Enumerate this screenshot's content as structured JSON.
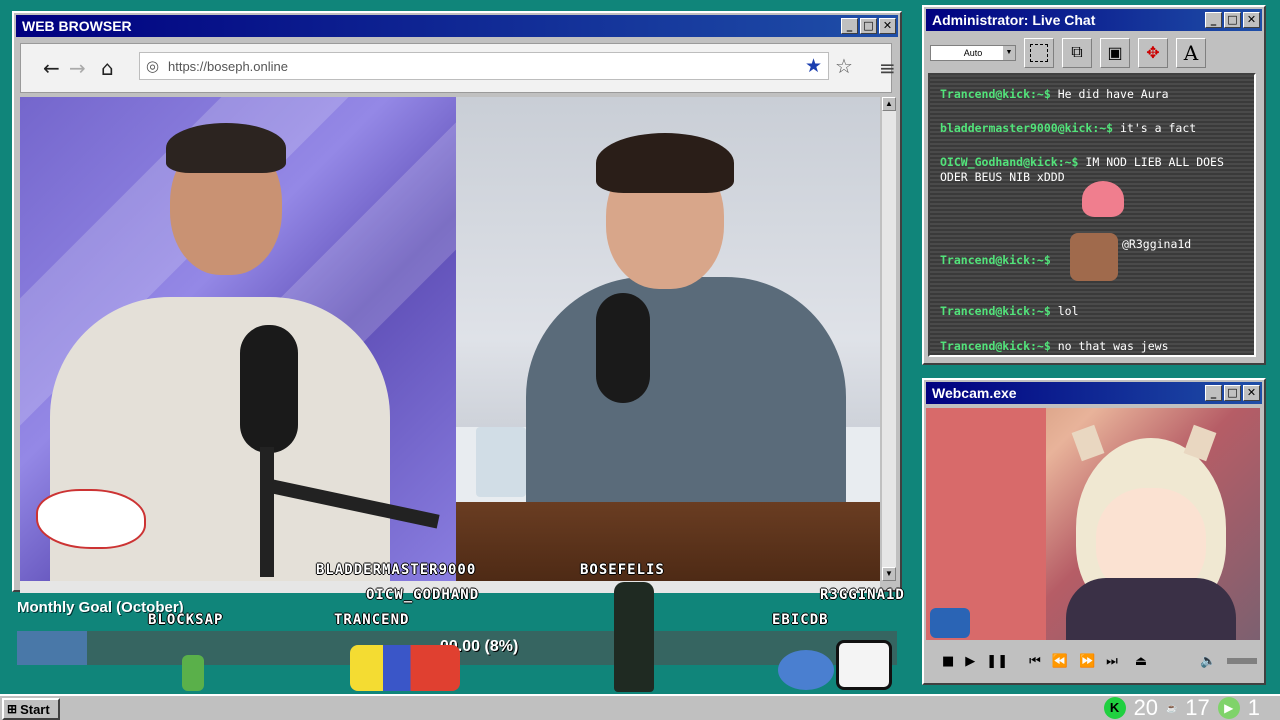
{
  "browser": {
    "title": "WEB BROWSER",
    "url": "https://boseph.online",
    "window_buttons": [
      "_",
      "□",
      "✕"
    ]
  },
  "chat": {
    "title": "Administrator: Live Chat",
    "font_size_select": "Auto",
    "messages": [
      {
        "user": "Trancend@kick:~$",
        "text": "He did have Aura"
      },
      {
        "user": "bladdermaster9000@kick:~$",
        "text": "it's a fact"
      },
      {
        "user": "OICW_Godhand@kick:~$",
        "text": "IM NOD LIEB ALL DOES ODER BEUS NIB xDDD"
      },
      {
        "user": "Trancend@kick:~$",
        "text": "@R3ggina1d"
      },
      {
        "user": "Trancend@kick:~$",
        "text": "lol"
      },
      {
        "user": "Trancend@kick:~$",
        "text": "no that was jews"
      }
    ]
  },
  "webcam": {
    "title": "Webcam.exe"
  },
  "goal": {
    "title": "Monthly Goal (October)",
    "amount_text": "00.00 (8%)",
    "percent": 8
  },
  "viewers": {
    "bladdermaster": "BLADDERMASTER9000",
    "bosefelis": "BOSEFELIS",
    "oicw": "OICW_GODHAND",
    "r3ggina1d": "R3GGINA1D",
    "blocksap": "BLOCKSAP",
    "trancend": "TRANCEND",
    "ebicdb": "EBICDB"
  },
  "taskbar": {
    "start_label": "Start",
    "tray_num_1": "20",
    "tray_num_2": "17",
    "tray_num_3": "1"
  }
}
